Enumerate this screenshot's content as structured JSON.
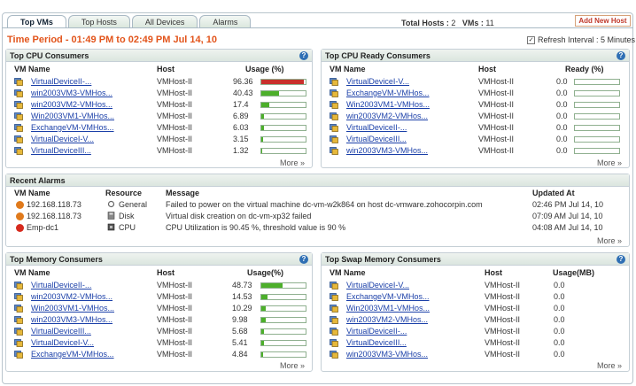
{
  "tabs": [
    "Top VMs",
    "Top Hosts",
    "All Devices",
    "Alarms"
  ],
  "counts": {
    "hosts_label": "Total Hosts : ",
    "hosts": "2",
    "vms_label": "VMs : ",
    "vms": "11"
  },
  "add_host": "Add New Host",
  "time_period": "Time Period - 01:49 PM to 02:49 PM Jul 14, 10",
  "refresh": {
    "checked": true,
    "label": "Refresh Interval : 5 Minutes"
  },
  "more": "More »",
  "cpu": {
    "title": "Top CPU Consumers",
    "cols": [
      "VM Name",
      "Host",
      "Usage (%)"
    ],
    "rows": [
      {
        "vm": "VirtualDeviceII-...",
        "host": "VMHost-II",
        "val": "96.36",
        "pct": 96.36,
        "color": "#c9302c"
      },
      {
        "vm": "win2003VM3-VMHos...",
        "host": "VMHost-II",
        "val": "40.43",
        "pct": 40.43,
        "color": "#4caf2a"
      },
      {
        "vm": "win2003VM2-VMHos...",
        "host": "VMHost-II",
        "val": "17.4",
        "pct": 17.4,
        "color": "#4caf2a"
      },
      {
        "vm": "Win2003VM1-VMHos...",
        "host": "VMHost-II",
        "val": "6.89",
        "pct": 6.89,
        "color": "#4caf2a"
      },
      {
        "vm": "ExchangeVM-VMHos...",
        "host": "VMHost-II",
        "val": "6.03",
        "pct": 6.03,
        "color": "#4caf2a"
      },
      {
        "vm": "VirtualDeviceI-V...",
        "host": "VMHost-II",
        "val": "3.15",
        "pct": 3.15,
        "color": "#4caf2a"
      },
      {
        "vm": "VirtualDeviceIII...",
        "host": "VMHost-II",
        "val": "1.32",
        "pct": 1.32,
        "color": "#4caf2a"
      }
    ]
  },
  "ready": {
    "title": "Top CPU Ready Consumers",
    "cols": [
      "VM Name",
      "Host",
      "Ready (%)"
    ],
    "rows": [
      {
        "vm": "VirtualDeviceI-V...",
        "host": "VMHost-II",
        "val": "0.0",
        "pct": 0
      },
      {
        "vm": "ExchangeVM-VMHos...",
        "host": "VMHost-II",
        "val": "0.0",
        "pct": 0
      },
      {
        "vm": "Win2003VM1-VMHos...",
        "host": "VMHost-II",
        "val": "0.0",
        "pct": 0
      },
      {
        "vm": "win2003VM2-VMHos...",
        "host": "VMHost-II",
        "val": "0.0",
        "pct": 0
      },
      {
        "vm": "VirtualDeviceII-...",
        "host": "VMHost-II",
        "val": "0.0",
        "pct": 0
      },
      {
        "vm": "VirtualDeviceIII...",
        "host": "VMHost-II",
        "val": "0.0",
        "pct": 0
      },
      {
        "vm": "win2003VM3-VMHos...",
        "host": "VMHost-II",
        "val": "0.0",
        "pct": 0
      }
    ]
  },
  "alarms": {
    "title": "Recent Alarms",
    "cols": [
      "VM Name",
      "Resource",
      "Message",
      "Updated At"
    ],
    "rows": [
      {
        "severity": "orange",
        "vm": "192.168.118.73",
        "resource": "General",
        "ricon": "general-icon",
        "message": "Failed to power on the virtual machine dc-vm-w2k864 on host dc-vmware.zohocorpin.com",
        "time": "02:46 PM Jul 14, 10"
      },
      {
        "severity": "orange",
        "vm": "192.168.118.73",
        "resource": "Disk",
        "ricon": "disk-icon",
        "message": "Virtual disk creation on dc-vm-xp32 failed",
        "time": "07:09 AM Jul 14, 10"
      },
      {
        "severity": "red",
        "vm": "Emp-dc1",
        "resource": "CPU",
        "ricon": "cpu-icon",
        "message": "CPU Utilization is 90.45 %, threshold value is 90 %",
        "time": "04:08 AM Jul 14, 10"
      }
    ]
  },
  "memory": {
    "title": "Top Memory Consumers",
    "cols": [
      "VM Name",
      "Host",
      "Usage(%)"
    ],
    "rows": [
      {
        "vm": "VirtualDeviceII-...",
        "host": "VMHost-II",
        "val": "48.73",
        "pct": 48.73,
        "color": "#4caf2a"
      },
      {
        "vm": "win2003VM2-VMHos...",
        "host": "VMHost-II",
        "val": "14.53",
        "pct": 14.53,
        "color": "#4caf2a"
      },
      {
        "vm": "Win2003VM1-VMHos...",
        "host": "VMHost-II",
        "val": "10.29",
        "pct": 10.29,
        "color": "#4caf2a"
      },
      {
        "vm": "win2003VM3-VMHos...",
        "host": "VMHost-II",
        "val": "9.98",
        "pct": 9.98,
        "color": "#4caf2a"
      },
      {
        "vm": "VirtualDeviceIII...",
        "host": "VMHost-II",
        "val": "5.68",
        "pct": 5.68,
        "color": "#4caf2a"
      },
      {
        "vm": "VirtualDeviceI-V...",
        "host": "VMHost-II",
        "val": "5.41",
        "pct": 5.41,
        "color": "#4caf2a"
      },
      {
        "vm": "ExchangeVM-VMHos...",
        "host": "VMHost-II",
        "val": "4.84",
        "pct": 4.84,
        "color": "#4caf2a"
      }
    ]
  },
  "swap": {
    "title": "Top Swap Memory Consumers",
    "cols": [
      "VM Name",
      "Host",
      "Usage(MB)"
    ],
    "rows": [
      {
        "vm": "VirtualDeviceI-V...",
        "host": "VMHost-II",
        "val": "0.0"
      },
      {
        "vm": "ExchangeVM-VMHos...",
        "host": "VMHost-II",
        "val": "0.0"
      },
      {
        "vm": "Win2003VM1-VMHos...",
        "host": "VMHost-II",
        "val": "0.0"
      },
      {
        "vm": "win2003VM2-VMHos...",
        "host": "VMHost-II",
        "val": "0.0"
      },
      {
        "vm": "VirtualDeviceII-...",
        "host": "VMHost-II",
        "val": "0.0"
      },
      {
        "vm": "VirtualDeviceIII...",
        "host": "VMHost-II",
        "val": "0.0"
      },
      {
        "vm": "win2003VM3-VMHos...",
        "host": "VMHost-II",
        "val": "0.0"
      }
    ]
  }
}
